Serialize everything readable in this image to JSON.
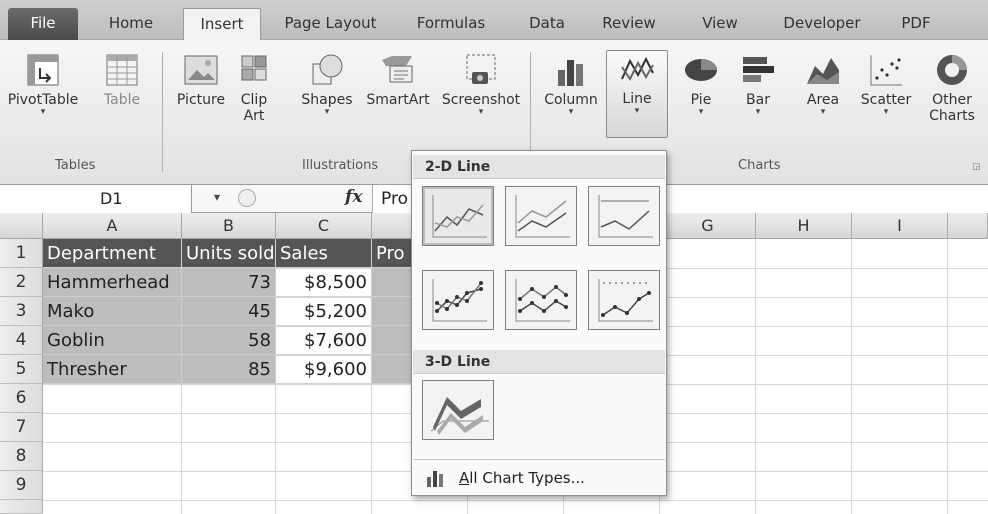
{
  "tabs": [
    "File",
    "Home",
    "Insert",
    "Page Layout",
    "Formulas",
    "Data",
    "Review",
    "View",
    "Developer",
    "PDF"
  ],
  "active_tab": "Insert",
  "ribbon": {
    "groups": {
      "tables": "Tables",
      "illustrations": "Illustrations",
      "charts": "Charts"
    },
    "buttons": {
      "pivottable": "PivotTable",
      "table": "Table",
      "picture": "Picture",
      "clipart": "Clip\nArt",
      "shapes": "Shapes",
      "smartart": "SmartArt",
      "screenshot": "Screenshot",
      "column": "Column",
      "line": "Line",
      "pie": "Pie",
      "bar": "Bar",
      "area": "Area",
      "scatter": "Scatter",
      "other": "Other\nCharts"
    }
  },
  "formula_bar": {
    "name_box": "D1",
    "fx": "fx",
    "value": "Pro"
  },
  "columns": [
    "A",
    "B",
    "C",
    "",
    "",
    "",
    "G",
    "H",
    "I"
  ],
  "rows": [
    "1",
    "2",
    "3",
    "4",
    "5",
    "6",
    "7",
    "8",
    "9"
  ],
  "table": {
    "headers": [
      "Department",
      "Units sold",
      "Sales",
      "Pro"
    ],
    "data": [
      [
        "Hammerhead",
        "73",
        "$8,500"
      ],
      [
        "Mako",
        "45",
        "$5,200"
      ],
      [
        "Goblin",
        "58",
        "$7,600"
      ],
      [
        "Thresher",
        "85",
        "$9,600"
      ]
    ]
  },
  "dropdown": {
    "section_2d": "2-D Line",
    "section_3d": "3-D Line",
    "footer_prefix": "A",
    "footer_rest": "ll Chart Types..."
  },
  "colors": {
    "header_fill": "#555555",
    "selection_fill": "#bdbdbd"
  }
}
